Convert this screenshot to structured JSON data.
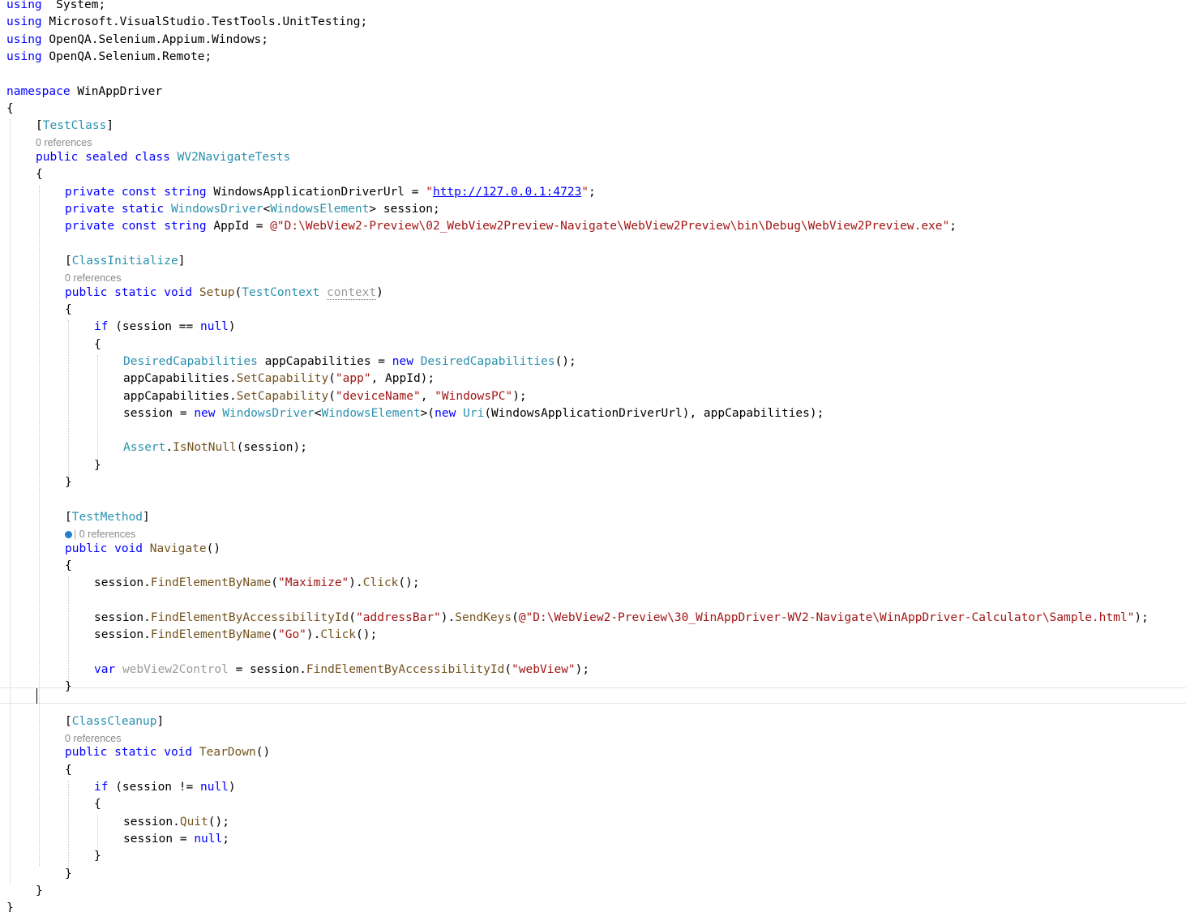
{
  "editor": {
    "lines": [
      {
        "kind": "code",
        "indent": 0,
        "tokens": [
          [
            "kw",
            "using"
          ],
          [
            "",
            "  System;"
          ]
        ]
      },
      {
        "kind": "code",
        "indent": 0,
        "tokens": [
          [
            "kw",
            "using"
          ],
          [
            "",
            " Microsoft.VisualStudio.TestTools.UnitTesting;"
          ]
        ]
      },
      {
        "kind": "code",
        "indent": 0,
        "tokens": [
          [
            "kw",
            "using"
          ],
          [
            "",
            " OpenQA.Selenium.Appium.Windows;"
          ]
        ]
      },
      {
        "kind": "code",
        "indent": 0,
        "tokens": [
          [
            "kw",
            "using"
          ],
          [
            "",
            " OpenQA.Selenium.Remote;"
          ]
        ]
      },
      {
        "kind": "code",
        "indent": 0,
        "tokens": []
      },
      {
        "kind": "code",
        "indent": 0,
        "tokens": [
          [
            "kw",
            "namespace"
          ],
          [
            "",
            " WinAppDriver"
          ]
        ]
      },
      {
        "kind": "code",
        "indent": 0,
        "tokens": [
          [
            "",
            "{"
          ]
        ]
      },
      {
        "kind": "code",
        "indent": 1,
        "tokens": [
          [
            "",
            "["
          ],
          [
            "ty",
            "TestClass"
          ],
          [
            "",
            "]"
          ]
        ]
      },
      {
        "kind": "lens",
        "indent": 1,
        "text": "0 references"
      },
      {
        "kind": "code",
        "indent": 1,
        "tokens": [
          [
            "kw",
            "public sealed class"
          ],
          [
            "",
            " "
          ],
          [
            "ty",
            "WV2NavigateTests"
          ]
        ]
      },
      {
        "kind": "code",
        "indent": 1,
        "tokens": [
          [
            "",
            "{"
          ]
        ]
      },
      {
        "kind": "code",
        "indent": 2,
        "tokens": [
          [
            "kw",
            "private const string"
          ],
          [
            "",
            " WindowsApplicationDriverUrl = "
          ],
          [
            "st",
            "\""
          ],
          [
            "lk",
            "http://127.0.0.1:4723"
          ],
          [
            "st",
            "\""
          ],
          [
            "",
            ";"
          ]
        ]
      },
      {
        "kind": "code",
        "indent": 2,
        "tokens": [
          [
            "kw",
            "private static"
          ],
          [
            "",
            " "
          ],
          [
            "ty",
            "WindowsDriver"
          ],
          [
            "",
            "<"
          ],
          [
            "ty",
            "WindowsElement"
          ],
          [
            "",
            "> session;"
          ]
        ]
      },
      {
        "kind": "code",
        "indent": 2,
        "tokens": [
          [
            "kw",
            "private const string"
          ],
          [
            "",
            " AppId = "
          ],
          [
            "st",
            "@\"D:\\WebView2-Preview\\02_WebView2Preview-Navigate\\WebView2Preview\\bin\\Debug\\WebView2Preview.exe\""
          ],
          [
            "",
            ";"
          ]
        ]
      },
      {
        "kind": "code",
        "indent": 2,
        "tokens": []
      },
      {
        "kind": "code",
        "indent": 2,
        "tokens": [
          [
            "",
            "["
          ],
          [
            "ty",
            "ClassInitialize"
          ],
          [
            "",
            "]"
          ]
        ]
      },
      {
        "kind": "lens",
        "indent": 2,
        "text": "0 references"
      },
      {
        "kind": "code",
        "indent": 2,
        "tokens": [
          [
            "kw",
            "public static void"
          ],
          [
            "",
            " "
          ],
          [
            "me",
            "Setup"
          ],
          [
            "",
            "("
          ],
          [
            "ty",
            "TestContext"
          ],
          [
            "",
            " "
          ],
          [
            "un",
            "context"
          ],
          [
            "",
            ")"
          ]
        ]
      },
      {
        "kind": "code",
        "indent": 2,
        "tokens": [
          [
            "",
            "{"
          ]
        ]
      },
      {
        "kind": "code",
        "indent": 3,
        "tokens": [
          [
            "kw",
            "if"
          ],
          [
            "",
            " (session == "
          ],
          [
            "kw",
            "null"
          ],
          [
            "",
            ")"
          ]
        ]
      },
      {
        "kind": "code",
        "indent": 3,
        "tokens": [
          [
            "",
            "{"
          ]
        ]
      },
      {
        "kind": "code",
        "indent": 4,
        "tokens": [
          [
            "ty",
            "DesiredCapabilities"
          ],
          [
            "",
            " appCapabilities = "
          ],
          [
            "kw",
            "new"
          ],
          [
            "",
            " "
          ],
          [
            "ty",
            "DesiredCapabilities"
          ],
          [
            "",
            "();"
          ]
        ]
      },
      {
        "kind": "code",
        "indent": 4,
        "tokens": [
          [
            "",
            "appCapabilities."
          ],
          [
            "me",
            "SetCapability"
          ],
          [
            "",
            "("
          ],
          [
            "st",
            "\"app\""
          ],
          [
            "",
            ", AppId);"
          ]
        ]
      },
      {
        "kind": "code",
        "indent": 4,
        "tokens": [
          [
            "",
            "appCapabilities."
          ],
          [
            "me",
            "SetCapability"
          ],
          [
            "",
            "("
          ],
          [
            "st",
            "\"deviceName\""
          ],
          [
            "",
            ", "
          ],
          [
            "st",
            "\"WindowsPC\""
          ],
          [
            "",
            ");"
          ]
        ]
      },
      {
        "kind": "code",
        "indent": 4,
        "tokens": [
          [
            "",
            "session = "
          ],
          [
            "kw",
            "new"
          ],
          [
            "",
            " "
          ],
          [
            "ty",
            "WindowsDriver"
          ],
          [
            "",
            "<"
          ],
          [
            "ty",
            "WindowsElement"
          ],
          [
            "",
            ">("
          ],
          [
            "kw",
            "new"
          ],
          [
            "",
            " "
          ],
          [
            "ty",
            "Uri"
          ],
          [
            "",
            "(WindowsApplicationDriverUrl), appCapabilities);"
          ]
        ]
      },
      {
        "kind": "code",
        "indent": 4,
        "tokens": []
      },
      {
        "kind": "code",
        "indent": 4,
        "tokens": [
          [
            "ty",
            "Assert"
          ],
          [
            "",
            "."
          ],
          [
            "me",
            "IsNotNull"
          ],
          [
            "",
            "(session);"
          ]
        ]
      },
      {
        "kind": "code",
        "indent": 3,
        "tokens": [
          [
            "",
            "}"
          ]
        ]
      },
      {
        "kind": "code",
        "indent": 2,
        "tokens": [
          [
            "",
            "}"
          ]
        ]
      },
      {
        "kind": "code",
        "indent": 2,
        "tokens": []
      },
      {
        "kind": "code",
        "indent": 2,
        "tokens": [
          [
            "",
            "["
          ],
          [
            "ty",
            "TestMethod"
          ],
          [
            "",
            "]"
          ]
        ]
      },
      {
        "kind": "lens",
        "indent": 2,
        "text": "0 references",
        "icon": true
      },
      {
        "kind": "code",
        "indent": 2,
        "tokens": [
          [
            "kw",
            "public void"
          ],
          [
            "",
            " "
          ],
          [
            "me",
            "Navigate"
          ],
          [
            "",
            "()"
          ]
        ]
      },
      {
        "kind": "code",
        "indent": 2,
        "tokens": [
          [
            "",
            "{"
          ]
        ]
      },
      {
        "kind": "code",
        "indent": 3,
        "tokens": [
          [
            "",
            "session."
          ],
          [
            "me",
            "FindElementByName"
          ],
          [
            "",
            "("
          ],
          [
            "st",
            "\"Maximize\""
          ],
          [
            "",
            ")."
          ],
          [
            "me",
            "Click"
          ],
          [
            "",
            "();"
          ]
        ]
      },
      {
        "kind": "code",
        "indent": 3,
        "tokens": []
      },
      {
        "kind": "code",
        "indent": 3,
        "tokens": [
          [
            "",
            "session."
          ],
          [
            "me",
            "FindElementByAccessibilityId"
          ],
          [
            "",
            "("
          ],
          [
            "st",
            "\"addressBar\""
          ],
          [
            "",
            ")."
          ],
          [
            "me",
            "SendKeys"
          ],
          [
            "",
            "("
          ],
          [
            "st",
            "@\"D:\\WebView2-Preview\\30_WinAppDriver-WV2-Navigate\\WinAppDriver-Calculator\\Sample.html\""
          ],
          [
            "",
            ");"
          ]
        ]
      },
      {
        "kind": "code",
        "indent": 3,
        "tokens": [
          [
            "",
            "session."
          ],
          [
            "me",
            "FindElementByName"
          ],
          [
            "",
            "("
          ],
          [
            "st",
            "\"Go\""
          ],
          [
            "",
            ")."
          ],
          [
            "me",
            "Click"
          ],
          [
            "",
            "();"
          ]
        ]
      },
      {
        "kind": "code",
        "indent": 3,
        "tokens": []
      },
      {
        "kind": "code",
        "indent": 3,
        "tokens": [
          [
            "kw",
            "var"
          ],
          [
            "",
            " "
          ],
          [
            "un",
            "webView2Control"
          ],
          [
            "",
            " = session."
          ],
          [
            "me",
            "FindElementByAccessibilityId"
          ],
          [
            "",
            "("
          ],
          [
            "st",
            "\"webView\""
          ],
          [
            "",
            ");"
          ]
        ]
      },
      {
        "kind": "code",
        "indent": 2,
        "tokens": [
          [
            "",
            "}"
          ]
        ]
      },
      {
        "kind": "code",
        "indent": 1,
        "tokens": [],
        "current": true
      },
      {
        "kind": "code",
        "indent": 2,
        "tokens": [
          [
            "",
            "["
          ],
          [
            "ty",
            "ClassCleanup"
          ],
          [
            "",
            "]"
          ]
        ]
      },
      {
        "kind": "lens",
        "indent": 2,
        "text": "0 references"
      },
      {
        "kind": "code",
        "indent": 2,
        "tokens": [
          [
            "kw",
            "public static void"
          ],
          [
            "",
            " "
          ],
          [
            "me",
            "TearDown"
          ],
          [
            "",
            "()"
          ]
        ]
      },
      {
        "kind": "code",
        "indent": 2,
        "tokens": [
          [
            "",
            "{"
          ]
        ]
      },
      {
        "kind": "code",
        "indent": 3,
        "tokens": [
          [
            "kw",
            "if"
          ],
          [
            "",
            " (session != "
          ],
          [
            "kw",
            "null"
          ],
          [
            "",
            ")"
          ]
        ]
      },
      {
        "kind": "code",
        "indent": 3,
        "tokens": [
          [
            "",
            "{"
          ]
        ]
      },
      {
        "kind": "code",
        "indent": 4,
        "tokens": [
          [
            "",
            "session."
          ],
          [
            "me",
            "Quit"
          ],
          [
            "",
            "();"
          ]
        ]
      },
      {
        "kind": "code",
        "indent": 4,
        "tokens": [
          [
            "",
            "session = "
          ],
          [
            "kw",
            "null"
          ],
          [
            "",
            ";"
          ]
        ]
      },
      {
        "kind": "code",
        "indent": 3,
        "tokens": [
          [
            "",
            "}"
          ]
        ]
      },
      {
        "kind": "code",
        "indent": 2,
        "tokens": [
          [
            "",
            "}"
          ]
        ]
      },
      {
        "kind": "code",
        "indent": 1,
        "tokens": [
          [
            "",
            "}"
          ]
        ]
      },
      {
        "kind": "code",
        "indent": 0,
        "tokens": [
          [
            "",
            "}"
          ]
        ]
      }
    ],
    "colors": {
      "keyword": "#0000ff",
      "type": "#2b91af",
      "string": "#a31515",
      "method": "#74531f",
      "unused": "#9a9a9a",
      "lens": "#8a8a8a",
      "info_icon": "#1e7fd0"
    },
    "icons": {
      "test_status": "info-circle-icon"
    }
  }
}
